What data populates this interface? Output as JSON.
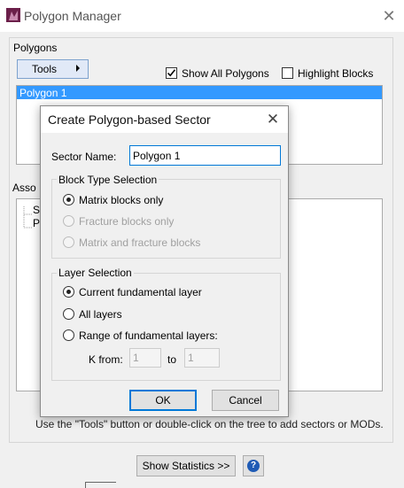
{
  "main_window": {
    "title": "Polygon Manager",
    "polygons_label": "Polygons",
    "tools_label": "Tools",
    "show_all_label": "Show All Polygons",
    "show_all_checked": true,
    "highlight_label": "Highlight Blocks",
    "highlight_checked": false,
    "polygon_items": [
      "Polygon 1"
    ],
    "assoc_label": "Asso",
    "tree_items": [
      "S",
      "P"
    ],
    "hint_text": "Use the \"Tools\" button or double-click on the tree to add sectors or MODs.",
    "stats_button": "Show Statistics >>",
    "help_glyph": "?"
  },
  "dialog": {
    "title": "Create Polygon-based Sector",
    "sector_name_label": "Sector Name:",
    "sector_name_value": "Polygon 1",
    "block_type_label": "Block Type Selection",
    "block_type_options": [
      {
        "label": "Matrix blocks only",
        "selected": true,
        "enabled": true
      },
      {
        "label": "Fracture blocks only",
        "selected": false,
        "enabled": false
      },
      {
        "label": "Matrix and fracture blocks",
        "selected": false,
        "enabled": false
      }
    ],
    "layer_label": "Layer Selection",
    "layer_options": [
      {
        "label": "Current fundamental layer",
        "selected": true
      },
      {
        "label": "All layers",
        "selected": false
      },
      {
        "label": "Range of fundamental layers:",
        "selected": false
      }
    ],
    "k_from_label": "K from:",
    "k_from_value": "1",
    "k_to_label": "to",
    "k_to_value": "1",
    "ok_label": "OK",
    "cancel_label": "Cancel"
  },
  "colors": {
    "selection": "#3399ff",
    "focus_blue": "#0078d7",
    "tools_button_bg": "#e1e9f7"
  }
}
